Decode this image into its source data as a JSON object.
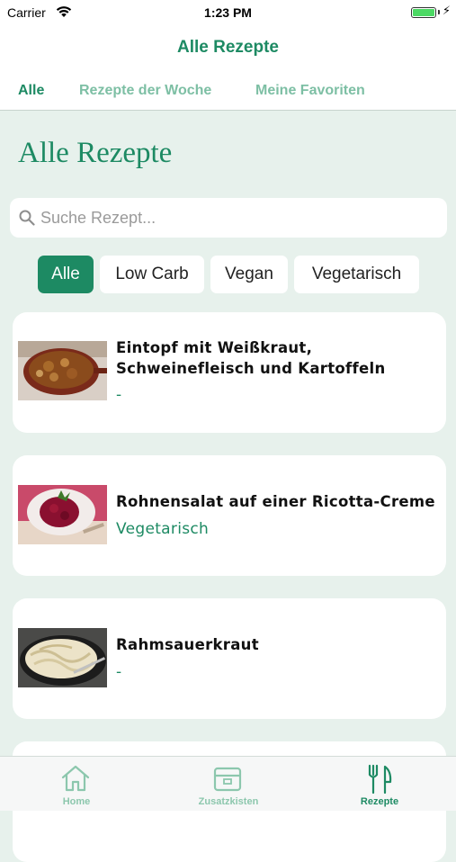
{
  "status_bar": {
    "carrier": "Carrier",
    "time": "1:23 PM",
    "battery_level": 1.0
  },
  "nav": {
    "title": "Alle Rezepte"
  },
  "tabs": [
    {
      "label": "Alle",
      "active": true
    },
    {
      "label": "Rezepte der Woche",
      "active": false
    },
    {
      "label": "Meine Favoriten",
      "active": false
    }
  ],
  "heading": "Alle Rezepte",
  "search": {
    "placeholder": "Suche Rezept...",
    "value": ""
  },
  "filters": [
    {
      "label": "Alle",
      "active": true
    },
    {
      "label": "Low Carb",
      "active": false
    },
    {
      "label": "Vegan",
      "active": false
    },
    {
      "label": "Vegetarisch",
      "active": false
    }
  ],
  "recipes": [
    {
      "title": "Eintopf mit Weißkraut, Schweinefleisch und Kartoffeln",
      "tag": "-",
      "image": "stew-pot-image"
    },
    {
      "title": "Rohnensalat auf einer Ricotta-Creme",
      "tag": "Vegetarisch",
      "image": "beet-salad-image"
    },
    {
      "title": "Rahmsauerkraut",
      "tag": "-",
      "image": "sauerkraut-pan-image"
    }
  ],
  "tabbar": [
    {
      "label": "Home",
      "icon": "home-icon",
      "active": false
    },
    {
      "label": "Zusatzkisten",
      "icon": "box-icon",
      "active": false
    },
    {
      "label": "Rezepte",
      "icon": "fork-knife-icon",
      "active": true
    }
  ],
  "colors": {
    "accent": "#1d8a63",
    "accent_light": "#7dbfa4",
    "background": "#e7f1ec"
  }
}
